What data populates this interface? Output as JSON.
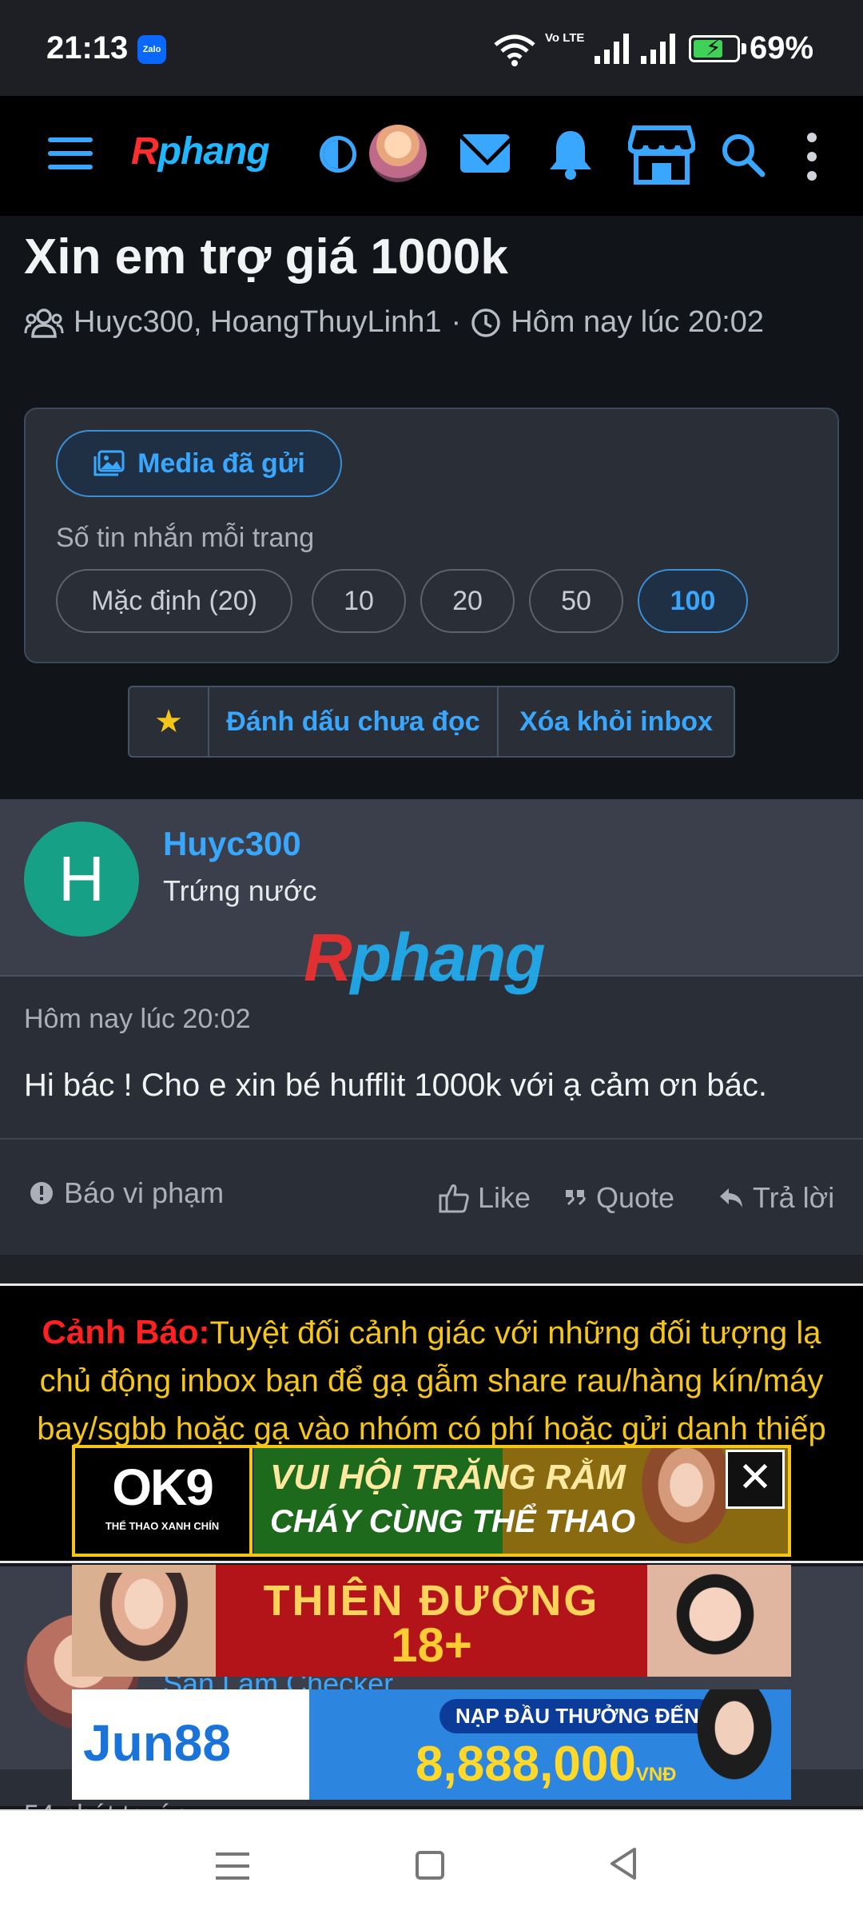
{
  "status_bar": {
    "time": "21:13",
    "notification_app": "Zalo",
    "network": "Vo LTE",
    "battery_percent": "69%",
    "battery_level": 0.69
  },
  "header": {
    "logo_first": "R",
    "logo_rest": "phang",
    "icons": [
      "menu-icon",
      "contrast-icon",
      "avatar",
      "mail-icon",
      "bell-icon",
      "store-icon",
      "search-icon",
      "more-vertical-icon"
    ]
  },
  "conversation": {
    "title": "Xin em trợ giá 1000k",
    "participants": "Huyc300, HoangThuyLinh1",
    "separator": "·",
    "time": "Hôm nay lúc 20:02",
    "media_button": "Media đã gửi",
    "per_page_label": "Số tin nhắn mỗi trang",
    "per_page_options": [
      "Mặc định (20)",
      "10",
      "20",
      "50",
      "100"
    ],
    "per_page_selected": "100",
    "star_icon": "★",
    "mark_unread": "Đánh dấu chưa đọc",
    "remove_inbox": "Xóa khỏi inbox"
  },
  "message": {
    "avatar_letter": "H",
    "author": "Huyc300",
    "rank": "Trứng nước",
    "watermark_first": "R",
    "watermark_rest": "phang",
    "time": "Hôm nay lúc 20:02",
    "body": "Hi bác ! Cho e xin bé hufflit 1000k với ạ cảm ơn bác.",
    "report": "Báo vi phạm",
    "like": "Like",
    "quote": "Quote",
    "reply": "Trả lời"
  },
  "warning": {
    "title": "Cảnh Báo:",
    "text": "Tuyệt đối cảnh giác với những đối tượng lạ chủ động inbox bạn để gạ gẫm share rau/hàng kín/máy bay/sgbb hoặc gạ vào nhóm có phí hoặc gửi danh thiếp"
  },
  "message2": {
    "rank": "San Lam Checker",
    "time": "54 phút trước"
  },
  "ads": {
    "ok9_brand": "OK9",
    "ok9_sub": "THỂ THAO XANH CHÍN",
    "ok9_line1": "VUI HỘI TRĂNG RẰM",
    "ok9_line2": "CHÁY CÙNG THỂ THAO",
    "close": "✕",
    "td_title": "THIÊN ĐƯỜNG",
    "td_number": "18+",
    "jun_brand": "Jun88",
    "jun_tag": "NẠP ĐẦU THƯỞNG ĐẾN",
    "jun_amount": "8,888,000",
    "jun_currency": "VNĐ"
  },
  "colors": {
    "accent": "#3aa7ff",
    "background": "#111418",
    "warning_title": "#ff2020",
    "warning_text": "#f5c518"
  }
}
